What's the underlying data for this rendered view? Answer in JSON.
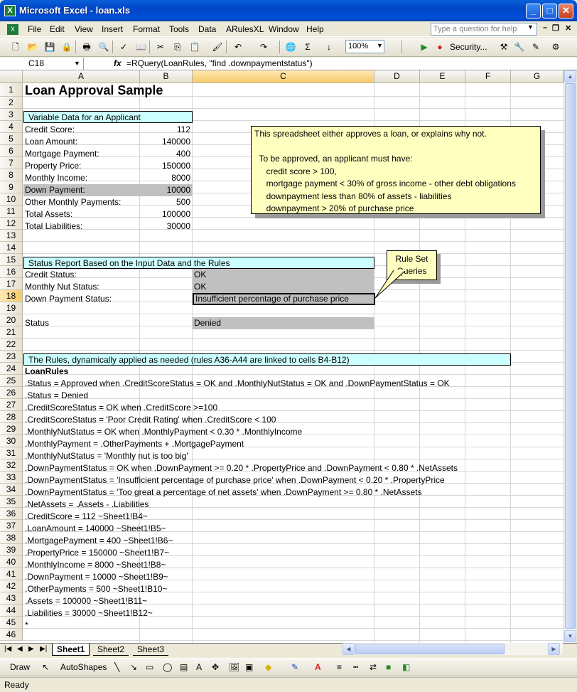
{
  "window": {
    "title": "Microsoft Excel - loan.xls",
    "app_icon": "excel-icon"
  },
  "menu": {
    "items": [
      "File",
      "Edit",
      "View",
      "Insert",
      "Format",
      "Tools",
      "Data",
      "ARulesXL",
      "Window",
      "Help"
    ],
    "ask_placeholder": "Type a question for help"
  },
  "toolbar": {
    "zoom": "100%",
    "security_label": "Security..."
  },
  "formula_bar": {
    "cell_ref": "C18",
    "fx": "fx",
    "formula": "=RQuery(LoanRules, \"find .downpaymentstatus\")"
  },
  "columns": [
    "A",
    "B",
    "C",
    "D",
    "E",
    "F",
    "G"
  ],
  "rows": [
    "1",
    "2",
    "3",
    "4",
    "5",
    "6",
    "7",
    "8",
    "9",
    "10",
    "11",
    "12",
    "13",
    "14",
    "15",
    "16",
    "17",
    "18",
    "19",
    "20",
    "21",
    "22",
    "23",
    "24",
    "25",
    "26",
    "27",
    "28",
    "29",
    "30",
    "31",
    "32",
    "33",
    "34",
    "35",
    "36",
    "37",
    "38",
    "39",
    "40",
    "41",
    "42",
    "43",
    "44",
    "45",
    "46"
  ],
  "sheet": {
    "title": "Loan Approval Sample",
    "variable_header": "Variable Data for an Applicant",
    "variables": [
      {
        "label": "Credit Score:",
        "value": "112"
      },
      {
        "label": "Loan Amount:",
        "value": "140000"
      },
      {
        "label": "Mortgage Payment:",
        "value": "400"
      },
      {
        "label": "Property Price:",
        "value": "150000"
      },
      {
        "label": "Monthly Income:",
        "value": "8000"
      },
      {
        "label": "Down Payment:",
        "value": "10000"
      },
      {
        "label": "Other Monthly Payments:",
        "value": "500"
      },
      {
        "label": "Total Assets:",
        "value": "100000"
      },
      {
        "label": "Total Liabilities:",
        "value": "30000"
      }
    ],
    "status_header": "Status Report Based on the Input Data and the Rules",
    "statuses": [
      {
        "label": "Credit Status:",
        "value": "OK"
      },
      {
        "label": "Monthly Nut Status:",
        "value": "OK"
      },
      {
        "label": "Down Payment Status:",
        "value": "Insufficient percentage of purchase price"
      }
    ],
    "final_status": {
      "label": "Status",
      "value": "Denied"
    },
    "rules_header": "The Rules, dynamically applied as needed (rules A36-A44 are linked to cells B4-B12)",
    "rules_title": "LoanRules",
    "rules": [
      ".Status = Approved when .CreditScoreStatus = OK and .MonthlyNutStatus = OK and .DownPaymentStatus = OK",
      ".Status = Denied",
      ".CreditScoreStatus = OK when .CreditScore >=100",
      ".CreditScoreStatus = 'Poor Credit Rating'  when .CreditScore < 100",
      ".MonthlyNutStatus = OK when .MonthlyPayment < 0.30 * .MonthlyIncome",
      ".MonthlyPayment = .OtherPayments + .MortgagePayment",
      ".MonthlyNutStatus = 'Monthly nut is too big'",
      ".DownPaymentStatus = OK when .DownPayment >= 0.20 * .PropertyPrice and .DownPayment < 0.80 * .NetAssets",
      ".DownPaymentStatus = 'Insufficient percentage of purchase price' when .DownPayment < 0.20 * .PropertyPrice",
      ".DownPaymentStatus = 'Too great a percentage of net assets' when .DownPayment >= 0.80 * .NetAssets",
      ".NetAssets = .Assets - .Liabilities",
      ".CreditScore = 112 ~Sheet1!B4~",
      ".LoanAmount = 140000 ~Sheet1!B5~",
      ".MortgagePayment = 400 ~Sheet1!B6~",
      ".PropertyPrice = 150000 ~Sheet1!B7~",
      ".MonthlyIncome = 8000 ~Sheet1!B8~",
      ".DownPayment =  10000 ~Sheet1!B9~",
      ".OtherPayments = 500 ~Sheet1!B10~",
      ".Assets = 100000 ~Sheet1!B11~",
      ".Liabilities = 30000 ~Sheet1!B12~",
      "*"
    ]
  },
  "note": {
    "lines": [
      "This spreadsheet either approves a loan, or explains why not.",
      "",
      "  To be approved, an applicant must have:",
      "     credit score > 100,",
      "     mortgage payment < 30% of gross income - other debt obligations",
      "     downpayment less than 80% of assets - liabilities",
      "     downpayment > 20% of purchase price"
    ]
  },
  "callout": {
    "line1": "Rule Set",
    "line2": "Queries"
  },
  "tabs": [
    "Sheet1",
    "Sheet2",
    "Sheet3"
  ],
  "drawing": {
    "draw_label": "Draw",
    "autoshapes_label": "AutoShapes"
  },
  "status_bar": "Ready",
  "colors": {
    "header_band": "#CCFFFF",
    "note_bg": "#FFFFC0",
    "gray_fill": "#C0C0C0",
    "title_bar": "#0050D8"
  }
}
